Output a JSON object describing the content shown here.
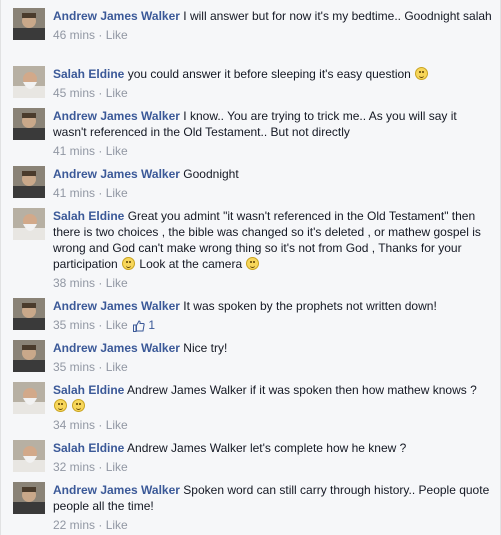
{
  "comments": [
    {
      "author": "Andrew James Walker",
      "avatar": "andrew-avatar",
      "text": "I will answer but for now it's my bedtime.. Goodnight salah",
      "time": "46 mins",
      "sep": " · ",
      "like": "Like"
    },
    {
      "author": "Salah Eldine",
      "avatar": "salah-avatar",
      "text": "you could answer it before sleeping it's easy question",
      "emoji_count": 1,
      "time": "45 mins",
      "sep": " · ",
      "like": "Like"
    },
    {
      "author": "Andrew James Walker",
      "avatar": "andrew-avatar",
      "text": "I know.. You are trying to trick me.. As you will say it wasn't referenced in the Old Testament.. But not directly",
      "time": "41 mins",
      "sep": " · ",
      "like": "Like"
    },
    {
      "author": "Andrew James Walker",
      "avatar": "andrew-avatar",
      "text": "Goodnight",
      "time": "41 mins",
      "sep": " · ",
      "like": "Like"
    },
    {
      "author": "Salah Eldine",
      "avatar": "salah-avatar",
      "text": "Great you admint \"it wasn't referenced in the Old Testament\" then there is two choices , the bible was changed so it's deleted , or mathew gospel is wrong and God can't make wrong thing so it's not from God , Thanks for your participation",
      "text2": "Look at the camera",
      "time": "38 mins",
      "sep": " · ",
      "like": "Like"
    },
    {
      "author": "Andrew James Walker",
      "avatar": "andrew-avatar",
      "text": "It was spoken by the prophets not written down!",
      "time": "35 mins",
      "sep": " · ",
      "like": "Like",
      "like_count": "1"
    },
    {
      "author": "Andrew James Walker",
      "avatar": "andrew-avatar",
      "text": "Nice try!",
      "time": "35 mins",
      "sep": " · ",
      "like": "Like"
    },
    {
      "author": "Salah Eldine",
      "avatar": "salah-avatar",
      "text": "Andrew James Walker if it was spoken then how mathew knows ?",
      "emoji_count": 2,
      "time": "34 mins",
      "sep": " · ",
      "like": "Like"
    },
    {
      "author": "Salah Eldine",
      "avatar": "salah-avatar",
      "text": "Andrew James Walker let's complete how he knew ?",
      "time": "32 mins",
      "sep": " · ",
      "like": "Like"
    },
    {
      "author": "Andrew James Walker",
      "avatar": "andrew-avatar",
      "text": "Spoken word can still carry through history.. People quote people all the time!",
      "time": "22 mins",
      "sep": " · ",
      "like": "Like"
    }
  ],
  "colors": {
    "author": "#3b5998",
    "meta": "#9197a3",
    "background": "#f6f7f9"
  },
  "icons": {
    "emoji": "smiley-icon",
    "like_count": "thumbs-up-icon"
  }
}
